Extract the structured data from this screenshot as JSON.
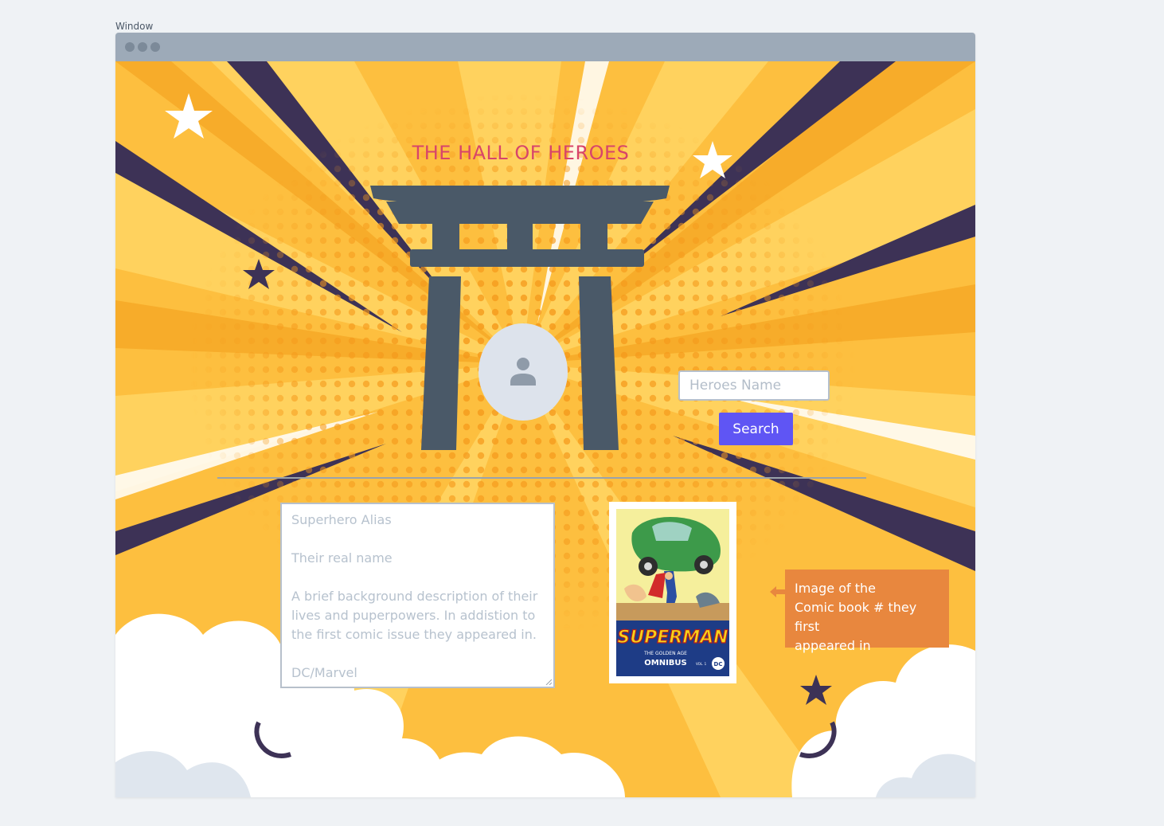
{
  "window": {
    "label": "Window"
  },
  "page": {
    "title": "THE HALL OF HEROES"
  },
  "search": {
    "placeholder": "Heroes Name",
    "button_label": "Search"
  },
  "description": {
    "alias": "Superhero Alias",
    "real_name": "Their real name",
    "background": "A brief background description of their lives and puperpowers. In addistion to the first comic issue they appeared in.",
    "publisher": "DC/Marvel"
  },
  "comic": {
    "title": "SUPERMAN",
    "subtitle1": "THE GOLDEN AGE",
    "subtitle2": "OMNIBUS",
    "volume": "VOL. 1",
    "logo": "DC"
  },
  "callout": {
    "text_line1": "Image of the",
    "text_line2": "Comic book # they first",
    "text_line3": "appeared in"
  },
  "icons": {
    "avatar": "user-silhouette-icon",
    "gate": "torii-gate-icon"
  },
  "colors": {
    "title": "#d8446a",
    "button": "#5f55f4",
    "callout": "#e8873e",
    "gate": "#4a5968",
    "titlebar": "#9daab8"
  }
}
